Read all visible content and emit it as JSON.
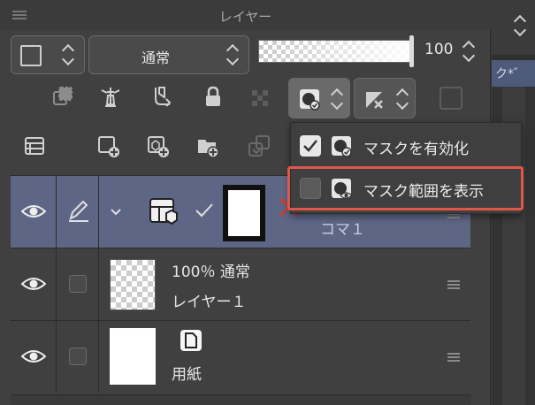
{
  "panel": {
    "title": "レイヤー"
  },
  "right_panel": {
    "tab_label": "ク*゛"
  },
  "toolbar": {
    "blend_mode": "通常",
    "opacity": 100,
    "opacity_label": "100",
    "opacity_fraction": 1.0
  },
  "menu": {
    "items": [
      {
        "label": "マスクを有効化",
        "checked": true
      },
      {
        "label": "マスク範囲を表示",
        "checked": false
      }
    ]
  },
  "layers": [
    {
      "name": "コマ１",
      "type": "frame-folder",
      "selected": true
    },
    {
      "blend_info": "100％ 通常",
      "name": "レイヤー１",
      "selected": false
    },
    {
      "name": "用紙",
      "type": "paper",
      "selected": false
    }
  ],
  "colors": {
    "panel_bg": "#404040",
    "selected_row": "#5e6686",
    "highlight_border": "#e0574a",
    "tab_accent": "#4e5a7a"
  },
  "icons": {
    "toolbar_row2": [
      "layer-stack-icon",
      "lighthouse-icon",
      "clip-icon",
      "lock-icon",
      "lock-transparent-icon",
      "mask-enable-icon",
      "ruler-icon"
    ],
    "toolbar_row3": [
      "layer-panel-icon",
      "new-raster-layer-icon",
      "new-vector-layer-icon",
      "new-folder-icon",
      "merge-down-icon"
    ]
  }
}
